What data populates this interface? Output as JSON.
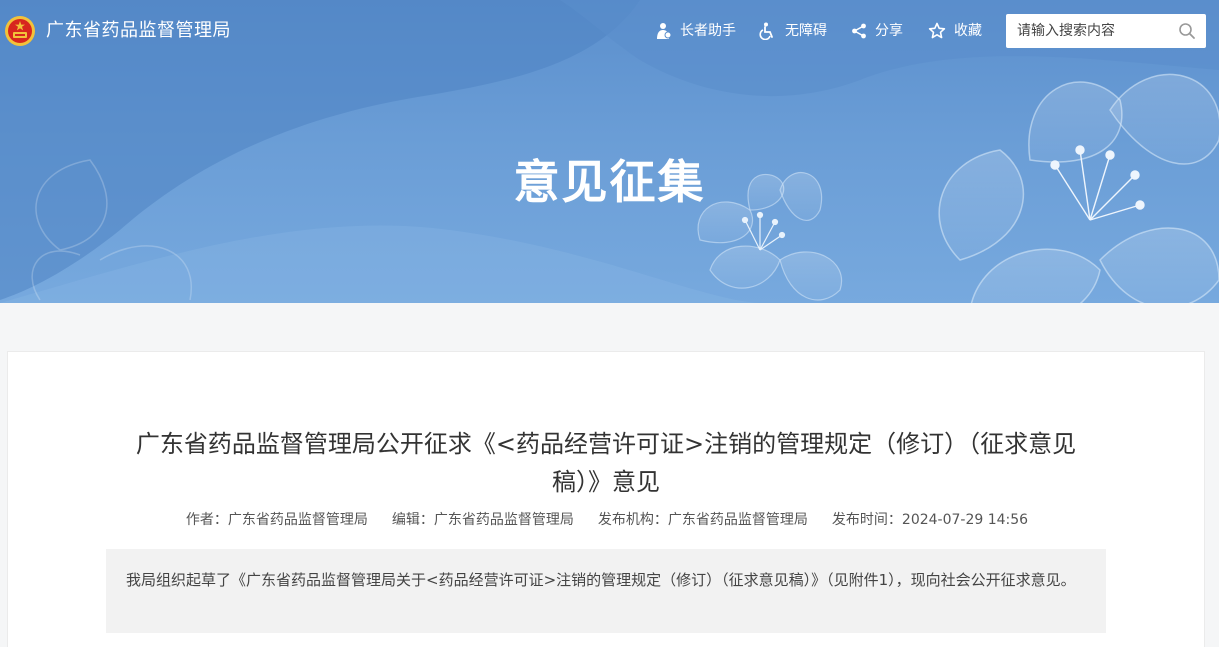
{
  "site": {
    "name": "广东省药品监督管理局"
  },
  "toolbar": {
    "elder_label": "长者助手",
    "accessibility_label": "无障碍",
    "share_label": "分享",
    "favorite_label": "收藏"
  },
  "search": {
    "placeholder": "请输入搜索内容"
  },
  "banner": {
    "title": "意见征集"
  },
  "article": {
    "title": "广东省药品监督管理局公开征求《<药品经营许可证>注销的管理规定（修订）（征求意见稿）》意见",
    "meta": {
      "author": "作者：广东省药品监督管理局",
      "editor": "编辑：广东省药品监督管理局",
      "publisher": "发布机构：广东省药品监督管理局",
      "publish_time": "发布时间：2024-07-29 14:56"
    },
    "summary": "我局组织起草了《广东省药品监督管理局关于<药品经营许可证>注销的管理规定（修订）（征求意见稿）》（见附件1），现向社会公开征求意见。"
  },
  "colors": {
    "banner_blue": "#5b8fcd",
    "page_bg": "#f5f6f7",
    "card_bg": "#ffffff",
    "summary_bg": "#f2f2f2",
    "emblem_red": "#d7261e",
    "emblem_gold": "#f2c23a"
  },
  "icons": {
    "logo": "national-emblem-icon",
    "elder": "elder-assist-icon",
    "accessibility": "wheelchair-icon",
    "share": "share-icon",
    "favorite": "star-icon",
    "search": "search-icon"
  }
}
